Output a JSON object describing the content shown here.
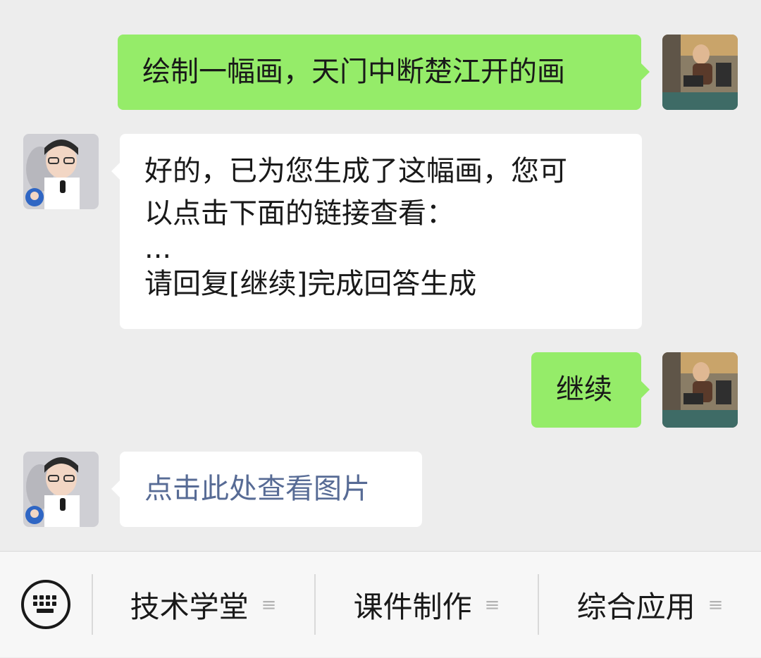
{
  "messages": [
    {
      "direction": "sent",
      "lines": [
        "绘制一幅画，天门中断楚江开的画"
      ]
    },
    {
      "direction": "received",
      "lines": [
        "好的，已为您生成了这幅画，您可",
        "以点击下面的链接查看：",
        "...",
        "请回复[继续]完成回答生成"
      ]
    },
    {
      "direction": "sent",
      "lines": [
        "继续"
      ]
    },
    {
      "direction": "received",
      "link_text": "点击此处查看图片"
    }
  ],
  "bottom_menu": {
    "keyboard_icon": "keyboard-icon",
    "menu_glyph": "≡",
    "items": [
      {
        "label": "技术学堂"
      },
      {
        "label": "课件制作"
      },
      {
        "label": "综合应用"
      }
    ]
  },
  "colors": {
    "background": "#ededed",
    "sent_bubble": "#95ec69",
    "received_bubble": "#ffffff",
    "link": "#576b95",
    "bottom_bar": "#f7f7f7"
  }
}
